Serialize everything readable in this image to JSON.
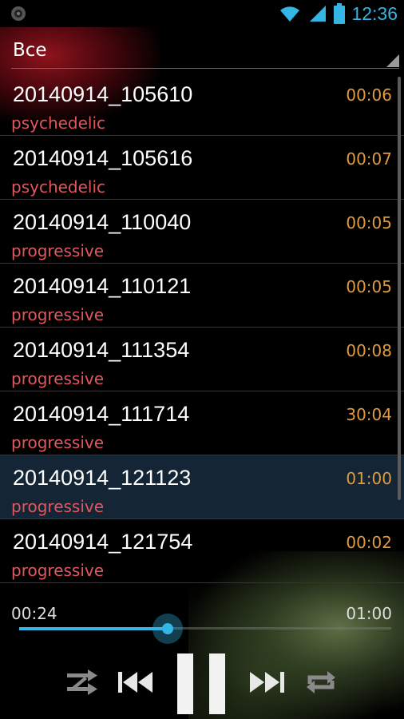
{
  "status_bar": {
    "time": "12:36",
    "icons": [
      "notification-icon",
      "wifi-icon",
      "signal-icon",
      "battery-icon"
    ],
    "accent": "#33b5e5"
  },
  "header": {
    "title": "Все"
  },
  "tracks": [
    {
      "title": "20140914_105610",
      "genre": "psychedelic",
      "duration": "00:06",
      "selected": false
    },
    {
      "title": "20140914_105616",
      "genre": "psychedelic",
      "duration": "00:07",
      "selected": false
    },
    {
      "title": "20140914_110040",
      "genre": "progressive",
      "duration": "00:05",
      "selected": false
    },
    {
      "title": "20140914_110121",
      "genre": "progressive",
      "duration": "00:05",
      "selected": false
    },
    {
      "title": "20140914_111354",
      "genre": "progressive",
      "duration": "00:08",
      "selected": false
    },
    {
      "title": "20140914_111714",
      "genre": "progressive",
      "duration": "30:04",
      "selected": false
    },
    {
      "title": "20140914_121123",
      "genre": "progressive",
      "duration": "01:00",
      "selected": true
    },
    {
      "title": "20140914_121754",
      "genre": "progressive",
      "duration": "00:02",
      "selected": false
    }
  ],
  "player": {
    "elapsed": "00:24",
    "total": "01:00",
    "progress_fraction": 0.4,
    "controls": [
      "shuffle-icon",
      "previous-icon",
      "pause-icon",
      "next-icon",
      "repeat-icon"
    ]
  },
  "colors": {
    "title": "#ffffff",
    "genre": "#e0585e",
    "duration": "#e19b3c",
    "selected_row": "#142535",
    "seek": "#33b5e5"
  }
}
